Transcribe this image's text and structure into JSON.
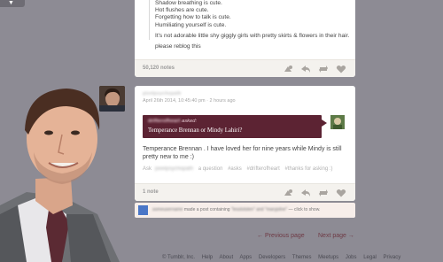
{
  "post1": {
    "quote_lines": [
      "Shadow breathing is cute.",
      "Hot flushes are cute.",
      "Forgetting how to talk is cute.",
      "Humiliating yourself is cute."
    ],
    "body": "It's not adorable little shy giggly girls with pretty skirts & flowers in their hair.",
    "reblog": "please reblog this",
    "notes": "50,120 notes"
  },
  "post2": {
    "username": "pixelpsychopath",
    "date": "April 26th 2014, 10:45:40 pm · 2 hours ago",
    "asker": "drifterofheart",
    "asked_label": "asked:",
    "question": "Temperance Brennan or Mindy Lahiri?",
    "answer_lines": [
      "Temperance Brennan . I have loved her for nine years while Mindy is still",
      "pretty new to me :)"
    ],
    "tag_prefix": "Ask",
    "tag_user": "pixelpsychopath",
    "tag_mid": "a question",
    "tags": [
      "#asks",
      "#drifterofheart",
      "#thanks for asking :)"
    ],
    "notes": "1 note"
  },
  "activity": {
    "user": "someusername",
    "text_a": "made a post containing",
    "blur_terms": "\"lesslolsten\" and \"maryjolne\"",
    "text_b": "— click to show."
  },
  "pager": {
    "prev": "← Previous page",
    "next": "Next page →"
  },
  "footer": {
    "links": [
      "© Tumblr, Inc.",
      "Help",
      "About",
      "Apps",
      "Developers",
      "Themes",
      "Meetups",
      "Jobs",
      "Legal",
      "Privacy"
    ]
  },
  "colors": {
    "background": "#8d8b94",
    "ask_box": "#5c2333",
    "pager_link": "#6e3a45"
  }
}
